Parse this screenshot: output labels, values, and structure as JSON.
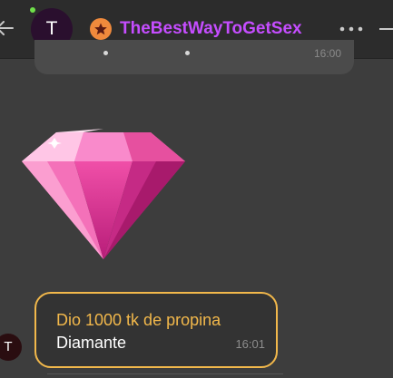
{
  "header": {
    "avatar_letter": "T",
    "username": "TheBestWayToGetSex",
    "online": true
  },
  "previous_message": {
    "time": "16:00"
  },
  "tip_message": {
    "sticker": "diamond-gem",
    "text": "Dio 1000 tk de propina",
    "gift_name": "Diamante",
    "time": "16:01",
    "sender_avatar_letter": "T"
  },
  "colors": {
    "background": "#3d3d3d",
    "header": "#2c2c2c",
    "username": "#c54dff",
    "tip_accent": "#f2b84b",
    "online": "#6fe04a",
    "badge": "#f08a3c"
  }
}
